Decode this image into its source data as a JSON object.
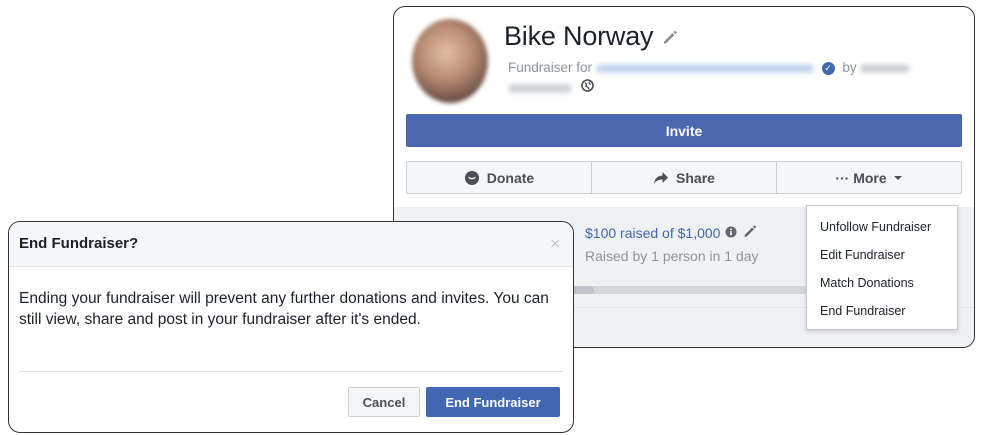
{
  "fundraiser": {
    "title": "Bike Norway",
    "subtitle_prefix": "Fundraiser for",
    "by_label": "by",
    "invite_label": "Invite",
    "actions": {
      "donate": "Donate",
      "share": "Share",
      "more": "··· More"
    },
    "raised_text": "$100 raised of $1,000",
    "raised_sub": "Raised by 1 person in 1 day",
    "progress_fraction": 0.1,
    "accent_color": "#4267b2"
  },
  "more_menu": {
    "items": [
      {
        "label": "Unfollow Fundraiser"
      },
      {
        "label": "Edit Fundraiser"
      },
      {
        "label": "Match Donations"
      },
      {
        "label": "End Fundraiser"
      }
    ]
  },
  "dialog": {
    "title": "End Fundraiser?",
    "close_glyph": "×",
    "body": "Ending your fundraiser will prevent any further donations and invites. You can still view, share and post in your fundraiser after it's ended.",
    "cancel_label": "Cancel",
    "confirm_label": "End Fundraiser"
  },
  "icons": {
    "edit": "pencil-icon",
    "verified": "verified-check-icon",
    "privacy": "globe-icon",
    "donate": "donate-icon",
    "share": "share-arrow-icon",
    "more_dropdown": "caret-down-icon",
    "info": "info-icon",
    "close": "close-icon"
  }
}
